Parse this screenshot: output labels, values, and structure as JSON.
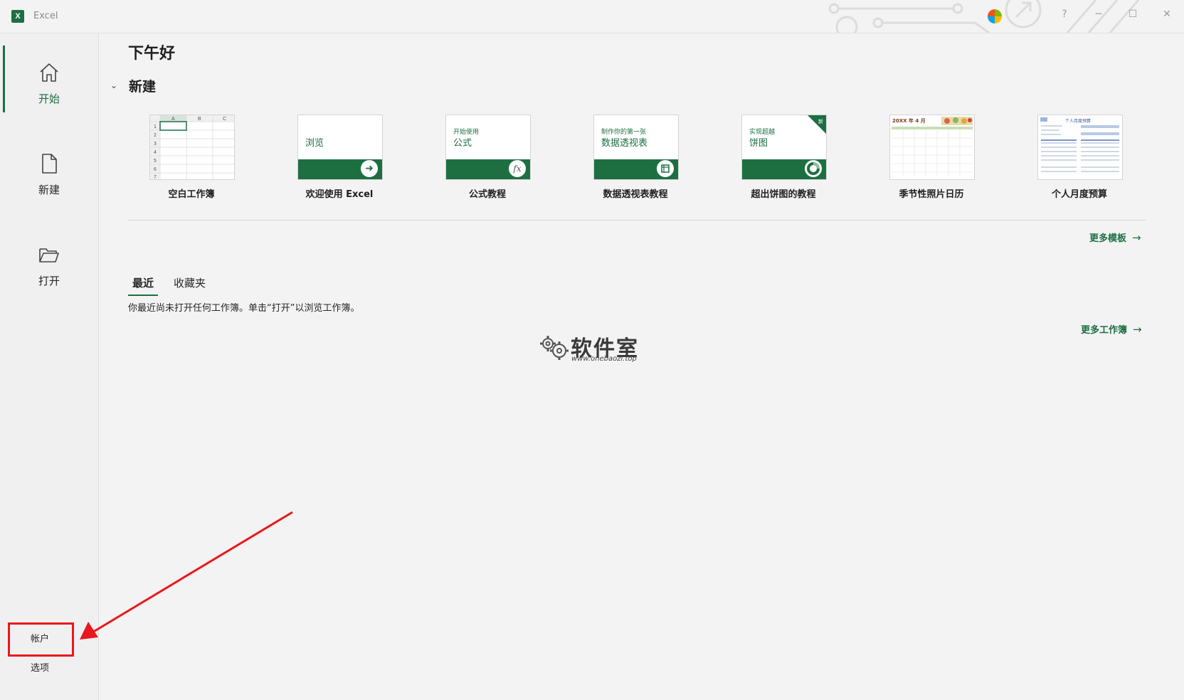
{
  "window": {
    "app_title": "Excel",
    "app_icon": "excel-icon",
    "controls": [
      "?",
      "─",
      "☐",
      "✕"
    ]
  },
  "nav": {
    "items": [
      {
        "label": "开始",
        "icon": "home-icon",
        "active": true
      },
      {
        "label": "新建",
        "icon": "new-document-icon",
        "active": false
      },
      {
        "label": "打开",
        "icon": "open-folder-icon",
        "active": false
      }
    ],
    "bottom": [
      {
        "label": "帐户"
      },
      {
        "label": "选项"
      }
    ]
  },
  "main": {
    "greeting": "下午好",
    "new_section": {
      "title": "新建",
      "templates": [
        {
          "label": "空白工作簿",
          "thumb_type": "blank"
        },
        {
          "label": "欢迎使用 Excel",
          "thumb_type": "tour",
          "thumb_big": "浏览",
          "thumb_small": ""
        },
        {
          "label": "公式教程",
          "thumb_type": "tour",
          "thumb_small": "开始使用",
          "thumb_big": "公式"
        },
        {
          "label": "数据透视表教程",
          "thumb_type": "tour",
          "thumb_small": "制作你的第一张",
          "thumb_big": "数据透视表"
        },
        {
          "label": "超出饼图的教程",
          "thumb_type": "tour",
          "thumb_small": "实现超越",
          "thumb_big": "饼图",
          "badge": "新"
        },
        {
          "label": "季节性照片日历",
          "thumb_type": "calendar",
          "thumb_title": "20XX 年 4 月"
        },
        {
          "label": "个人月度预算",
          "thumb_type": "budget",
          "thumb_title": "个人月度预算"
        }
      ],
      "blank_thumb": {
        "columns": [
          "A",
          "B",
          "C"
        ],
        "rows": [
          "1",
          "2",
          "3",
          "4",
          "5",
          "6",
          "7"
        ]
      },
      "more_templates": "更多模板"
    },
    "recent": {
      "tabs": [
        "最近",
        "收藏夹"
      ],
      "active_tab": "最近",
      "empty_message": "你最近尚未打开任何工作簿。单击“打开”以浏览工作簿。",
      "more_workbooks": "更多工作簿"
    },
    "watermark": {
      "text": "软件室",
      "url": "www.onebaozi.top"
    }
  },
  "colors": {
    "accent": "#1d6f42",
    "background": "#f3f3f3",
    "annotation": "#e8181d"
  }
}
